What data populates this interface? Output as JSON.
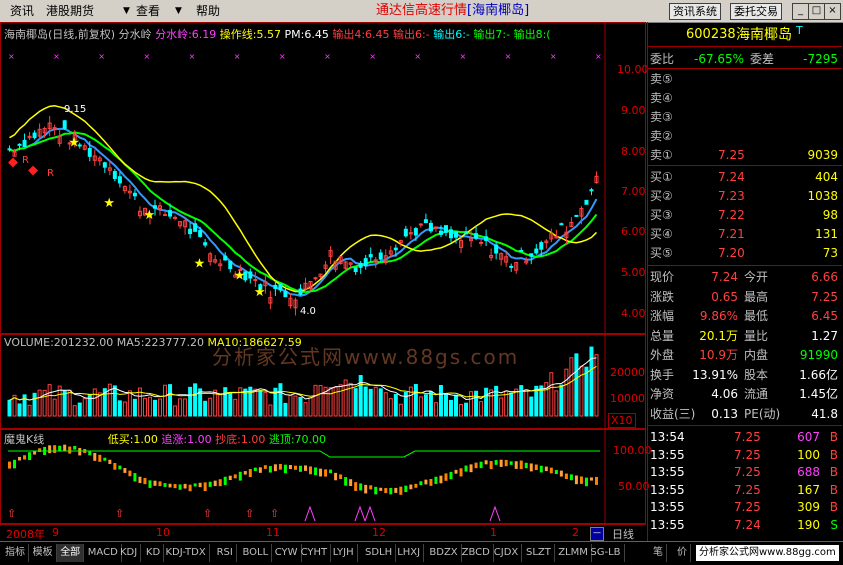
{
  "menu": {
    "items": [
      "资讯",
      "港股期货",
      "查看",
      "帮助"
    ],
    "title_main": "通达信高速行情",
    "title_sub": "[海南椰岛]",
    "btn_info_system": "资讯系统",
    "btn_trade": "委托交易"
  },
  "price_pane": {
    "header_name": "海南椰岛(日线,前复权)",
    "indicator_name": "分水岭",
    "fsl_label": "分水岭:6.19",
    "czx_label": "操作线:5.57",
    "pm_label": "PM:6.45",
    "out4_label": "输出4:6.45",
    "out6_label": "输出6:-",
    "out6b_label": "输出6:-",
    "out7_label": "输出7:-",
    "out8_label": "输出8:(",
    "y_ticks": [
      "10.00",
      "9.00",
      "8.00",
      "7.00",
      "6.00",
      "5.00",
      "4.00"
    ],
    "high_label": "9.15",
    "low_label": "4.0",
    "r_marker": "R"
  },
  "volume_pane": {
    "vol_label": "VOLUME:201232.00",
    "ma5_label": "MA5:223777.20",
    "ma10_label": "MA10:186627.59",
    "y_ticks": [
      "20000",
      "10000"
    ],
    "unit": "X10"
  },
  "kline_pane": {
    "name": "魔鬼K线",
    "dimai": "低买:1.00",
    "zhuizhang": "追涨:1.00",
    "chaodi": "抄底:1.00",
    "taopao": "逃顶:70.00",
    "y_ticks": [
      "100.00",
      "50.00"
    ]
  },
  "date_axis": {
    "labels": [
      "2008年",
      "9",
      "10",
      "11",
      "12",
      "1",
      "2"
    ],
    "period": "日线"
  },
  "quote": {
    "code": "600238",
    "name": "海南椰岛",
    "flag": "T",
    "weibi_label": "委比",
    "weibi_value": "-67.65%",
    "weicha_label": "委差",
    "weicha_value": "-7295",
    "sell": [
      {
        "label": "卖⑤",
        "price": "",
        "vol": ""
      },
      {
        "label": "卖④",
        "price": "",
        "vol": ""
      },
      {
        "label": "卖③",
        "price": "",
        "vol": ""
      },
      {
        "label": "卖②",
        "price": "",
        "vol": ""
      },
      {
        "label": "卖①",
        "price": "7.25",
        "vol": "9039"
      }
    ],
    "buy": [
      {
        "label": "买①",
        "price": "7.24",
        "vol": "404"
      },
      {
        "label": "买②",
        "price": "7.23",
        "vol": "1038"
      },
      {
        "label": "买③",
        "price": "7.22",
        "vol": "98"
      },
      {
        "label": "买④",
        "price": "7.21",
        "vol": "131"
      },
      {
        "label": "买⑤",
        "price": "7.20",
        "vol": "73"
      }
    ],
    "stats": [
      {
        "l1": "现价",
        "v1": "7.24",
        "l2": "今开",
        "v2": "6.66",
        "c1": "#ff4040",
        "c2": "#ff4040"
      },
      {
        "l1": "涨跌",
        "v1": "0.65",
        "l2": "最高",
        "v2": "7.25",
        "c1": "#ff4040",
        "c2": "#ff4040"
      },
      {
        "l1": "涨幅",
        "v1": "9.86%",
        "l2": "最低",
        "v2": "6.45",
        "c1": "#ff4040",
        "c2": "#ff4040"
      },
      {
        "l1": "总量",
        "v1": "20.1万",
        "l2": "量比",
        "v2": "1.27",
        "c1": "#ffff00",
        "c2": "#ffffff"
      },
      {
        "l1": "外盘",
        "v1": "10.9万",
        "l2": "内盘",
        "v2": "91990",
        "c1": "#ff4040",
        "c2": "#00ff00"
      },
      {
        "l1": "换手",
        "v1": "13.91%",
        "l2": "股本",
        "v2": "1.66亿",
        "c1": "#ffffff",
        "c2": "#ffffff"
      },
      {
        "l1": "净资",
        "v1": "4.06",
        "l2": "流通",
        "v2": "1.45亿",
        "c1": "#ffffff",
        "c2": "#ffffff"
      },
      {
        "l1": "收益(三)",
        "v1": "0.13",
        "l2": "PE(动)",
        "v2": "41.8",
        "c1": "#ffffff",
        "c2": "#ffffff"
      }
    ],
    "ticks": [
      {
        "time": "13:54",
        "price": "7.25",
        "vol": "607",
        "side": "B",
        "vc": "#ff40ff"
      },
      {
        "time": "13:55",
        "price": "7.25",
        "vol": "100",
        "side": "B",
        "vc": "#ffff00"
      },
      {
        "time": "13:55",
        "price": "7.25",
        "vol": "688",
        "side": "B",
        "vc": "#ff40ff"
      },
      {
        "time": "13:55",
        "price": "7.25",
        "vol": "167",
        "side": "B",
        "vc": "#ffff00"
      },
      {
        "time": "13:55",
        "price": "7.25",
        "vol": "309",
        "side": "B",
        "vc": "#ffff00"
      },
      {
        "time": "13:55",
        "price": "7.24",
        "vol": "190",
        "side": "S",
        "vc": "#ffff00"
      }
    ]
  },
  "tabs": [
    "指标",
    "模板",
    "全部",
    "MACD",
    "KDJ",
    "KD",
    "KDJ-TDX",
    "RSI",
    "BOLL",
    "CYW",
    "CYHT",
    "LYJH",
    "SDLH",
    "LHXJ",
    "BDZX",
    "ZBCD",
    "CJDX",
    "SLZT",
    "ZLMM",
    "SG-LB"
  ],
  "right_tabs": [
    "笔",
    "价"
  ],
  "watermark": "分析家公式网www.88gs.com",
  "watermark_small": "分析家公式网www.88gg.com",
  "colors": {
    "up": "#ff4040",
    "down": "#00ffff",
    "accent": "#ffff00",
    "bg": "#000000"
  }
}
